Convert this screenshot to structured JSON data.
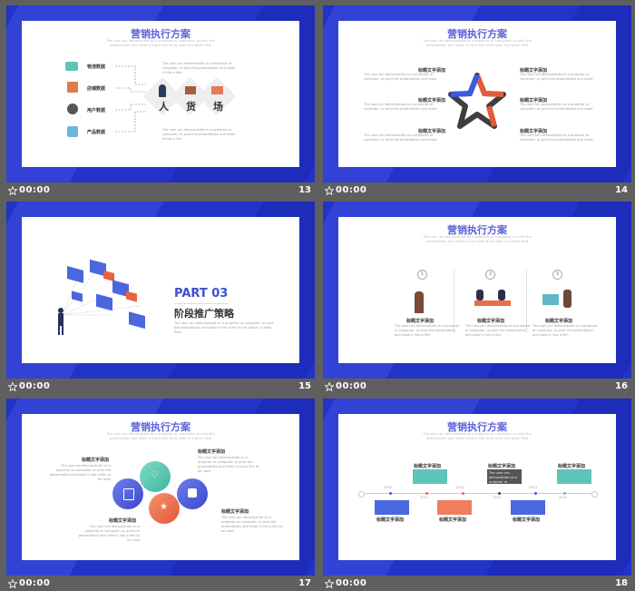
{
  "colors": {
    "background": "#5f5f5f",
    "frame": "#2233c8",
    "title": "#5b64d8"
  },
  "slides": [
    {
      "number": "13",
      "time": "00:00",
      "title": "营销执行方案",
      "subtitle": "The user can demonstrate on a projector or computer, or print the presentation and make it into a film to be used in a wider field",
      "items": [
        "物流数据",
        "店铺数据",
        "用户数据",
        "产品数据"
      ],
      "chars": [
        "人",
        "货",
        "场"
      ],
      "note": "The user can demonstrate on a projector or computer, or print the presentation and make it into a film"
    },
    {
      "number": "14",
      "time": "00:00",
      "title": "营销执行方案",
      "subtitle": "The user can demonstrate on a projector or computer, or print the presentation and make it into a film to be used in a wider field",
      "label": "标题文字添加",
      "note": "The user can demonstrate on a projector or computer, or print the presentation and make"
    },
    {
      "number": "15",
      "time": "00:00",
      "part": "PART 03",
      "heading": "阶段推广策略",
      "note": "The user can demonstrate on a projector or computer, or print the presentation and make it into a film to be used in a wider field"
    },
    {
      "number": "16",
      "time": "00:00",
      "title": "营销执行方案",
      "subtitle": "The user can demonstrate on a projector or computer, or print the presentation and make it into a film to be used in a wider field",
      "steps": [
        "1",
        "2",
        "3"
      ],
      "label": "标题文字添加",
      "note": "The user can demonstrate on a projector or computer, or print the presentation and make it into a film"
    },
    {
      "number": "17",
      "time": "00:00",
      "title": "营销执行方案",
      "subtitle": "The user can demonstrate on a projector or computer, or print the presentation and make it into a film to be used in a wider field",
      "label": "标题文字添加",
      "note": "The user can demonstrate on a projector or computer, or print the presentation and make it into a film to be used"
    },
    {
      "number": "18",
      "time": "00:00",
      "title": "营销执行方案",
      "subtitle": "The user can demonstrate on a projector or computer, or print the presentation and make it into a film to be used in a wider field",
      "years": [
        "2010",
        "2011",
        "2012",
        "2013",
        "2014",
        "2015"
      ],
      "label": "标题文字添加",
      "note": "The user can demonstrate on a projector or computer"
    }
  ]
}
